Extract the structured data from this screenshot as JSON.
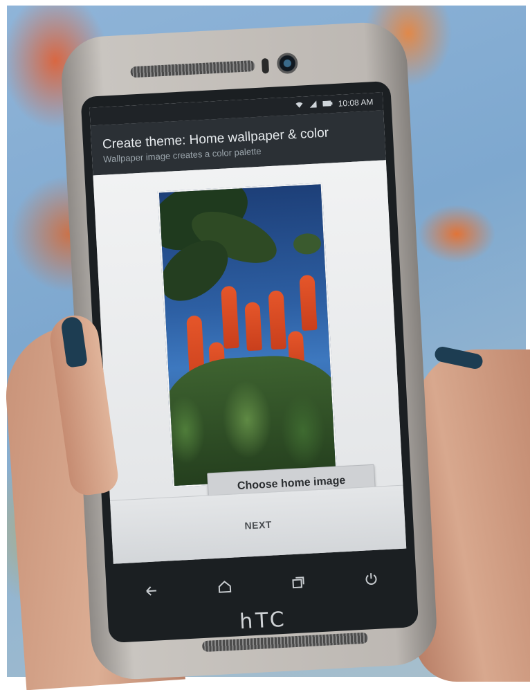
{
  "status_bar": {
    "time": "10:08 AM",
    "icons": [
      "wifi-icon",
      "signal-icon",
      "battery-icon"
    ]
  },
  "header": {
    "title": "Create theme: Home wallpaper & color",
    "subtitle": "Wallpaper image creates a color palette"
  },
  "main": {
    "choose_button_label": "Choose home image"
  },
  "footer": {
    "next_label": "NEXT"
  },
  "nav_bar": {
    "icons": [
      "back-icon",
      "home-icon",
      "recent-apps-icon",
      "power-icon"
    ]
  },
  "device": {
    "brand": "hTC"
  },
  "colors": {
    "title_bar": "#2b3035",
    "screen_bg": "#e9eaec",
    "button_bg": "#cfd1d4",
    "flower_accent": "#e5562a"
  }
}
